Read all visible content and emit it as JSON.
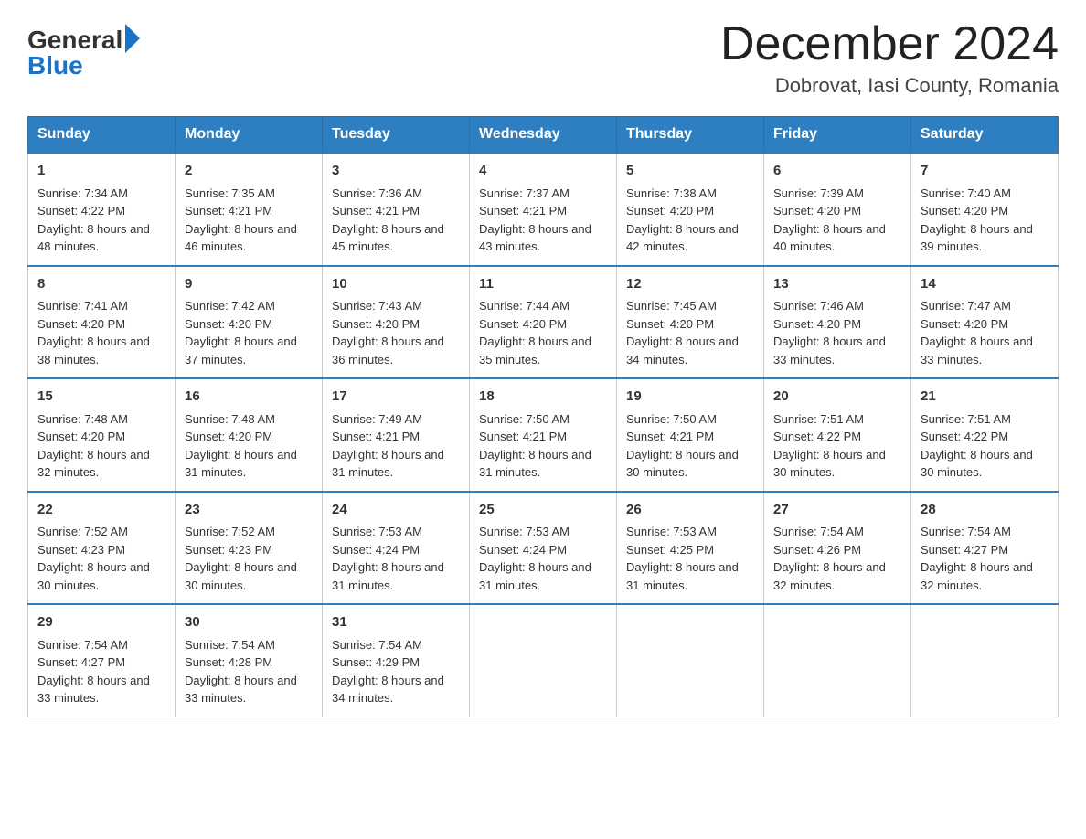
{
  "header": {
    "logo_general": "General",
    "logo_blue": "Blue",
    "month_title": "December 2024",
    "location": "Dobrovat, Iasi County, Romania"
  },
  "weekdays": [
    "Sunday",
    "Monday",
    "Tuesday",
    "Wednesday",
    "Thursday",
    "Friday",
    "Saturday"
  ],
  "weeks": [
    [
      {
        "day": "1",
        "sunrise": "7:34 AM",
        "sunset": "4:22 PM",
        "daylight": "8 hours and 48 minutes."
      },
      {
        "day": "2",
        "sunrise": "7:35 AM",
        "sunset": "4:21 PM",
        "daylight": "8 hours and 46 minutes."
      },
      {
        "day": "3",
        "sunrise": "7:36 AM",
        "sunset": "4:21 PM",
        "daylight": "8 hours and 45 minutes."
      },
      {
        "day": "4",
        "sunrise": "7:37 AM",
        "sunset": "4:21 PM",
        "daylight": "8 hours and 43 minutes."
      },
      {
        "day": "5",
        "sunrise": "7:38 AM",
        "sunset": "4:20 PM",
        "daylight": "8 hours and 42 minutes."
      },
      {
        "day": "6",
        "sunrise": "7:39 AM",
        "sunset": "4:20 PM",
        "daylight": "8 hours and 40 minutes."
      },
      {
        "day": "7",
        "sunrise": "7:40 AM",
        "sunset": "4:20 PM",
        "daylight": "8 hours and 39 minutes."
      }
    ],
    [
      {
        "day": "8",
        "sunrise": "7:41 AM",
        "sunset": "4:20 PM",
        "daylight": "8 hours and 38 minutes."
      },
      {
        "day": "9",
        "sunrise": "7:42 AM",
        "sunset": "4:20 PM",
        "daylight": "8 hours and 37 minutes."
      },
      {
        "day": "10",
        "sunrise": "7:43 AM",
        "sunset": "4:20 PM",
        "daylight": "8 hours and 36 minutes."
      },
      {
        "day": "11",
        "sunrise": "7:44 AM",
        "sunset": "4:20 PM",
        "daylight": "8 hours and 35 minutes."
      },
      {
        "day": "12",
        "sunrise": "7:45 AM",
        "sunset": "4:20 PM",
        "daylight": "8 hours and 34 minutes."
      },
      {
        "day": "13",
        "sunrise": "7:46 AM",
        "sunset": "4:20 PM",
        "daylight": "8 hours and 33 minutes."
      },
      {
        "day": "14",
        "sunrise": "7:47 AM",
        "sunset": "4:20 PM",
        "daylight": "8 hours and 33 minutes."
      }
    ],
    [
      {
        "day": "15",
        "sunrise": "7:48 AM",
        "sunset": "4:20 PM",
        "daylight": "8 hours and 32 minutes."
      },
      {
        "day": "16",
        "sunrise": "7:48 AM",
        "sunset": "4:20 PM",
        "daylight": "8 hours and 31 minutes."
      },
      {
        "day": "17",
        "sunrise": "7:49 AM",
        "sunset": "4:21 PM",
        "daylight": "8 hours and 31 minutes."
      },
      {
        "day": "18",
        "sunrise": "7:50 AM",
        "sunset": "4:21 PM",
        "daylight": "8 hours and 31 minutes."
      },
      {
        "day": "19",
        "sunrise": "7:50 AM",
        "sunset": "4:21 PM",
        "daylight": "8 hours and 30 minutes."
      },
      {
        "day": "20",
        "sunrise": "7:51 AM",
        "sunset": "4:22 PM",
        "daylight": "8 hours and 30 minutes."
      },
      {
        "day": "21",
        "sunrise": "7:51 AM",
        "sunset": "4:22 PM",
        "daylight": "8 hours and 30 minutes."
      }
    ],
    [
      {
        "day": "22",
        "sunrise": "7:52 AM",
        "sunset": "4:23 PM",
        "daylight": "8 hours and 30 minutes."
      },
      {
        "day": "23",
        "sunrise": "7:52 AM",
        "sunset": "4:23 PM",
        "daylight": "8 hours and 30 minutes."
      },
      {
        "day": "24",
        "sunrise": "7:53 AM",
        "sunset": "4:24 PM",
        "daylight": "8 hours and 31 minutes."
      },
      {
        "day": "25",
        "sunrise": "7:53 AM",
        "sunset": "4:24 PM",
        "daylight": "8 hours and 31 minutes."
      },
      {
        "day": "26",
        "sunrise": "7:53 AM",
        "sunset": "4:25 PM",
        "daylight": "8 hours and 31 minutes."
      },
      {
        "day": "27",
        "sunrise": "7:54 AM",
        "sunset": "4:26 PM",
        "daylight": "8 hours and 32 minutes."
      },
      {
        "day": "28",
        "sunrise": "7:54 AM",
        "sunset": "4:27 PM",
        "daylight": "8 hours and 32 minutes."
      }
    ],
    [
      {
        "day": "29",
        "sunrise": "7:54 AM",
        "sunset": "4:27 PM",
        "daylight": "8 hours and 33 minutes."
      },
      {
        "day": "30",
        "sunrise": "7:54 AM",
        "sunset": "4:28 PM",
        "daylight": "8 hours and 33 minutes."
      },
      {
        "day": "31",
        "sunrise": "7:54 AM",
        "sunset": "4:29 PM",
        "daylight": "8 hours and 34 minutes."
      },
      null,
      null,
      null,
      null
    ]
  ]
}
